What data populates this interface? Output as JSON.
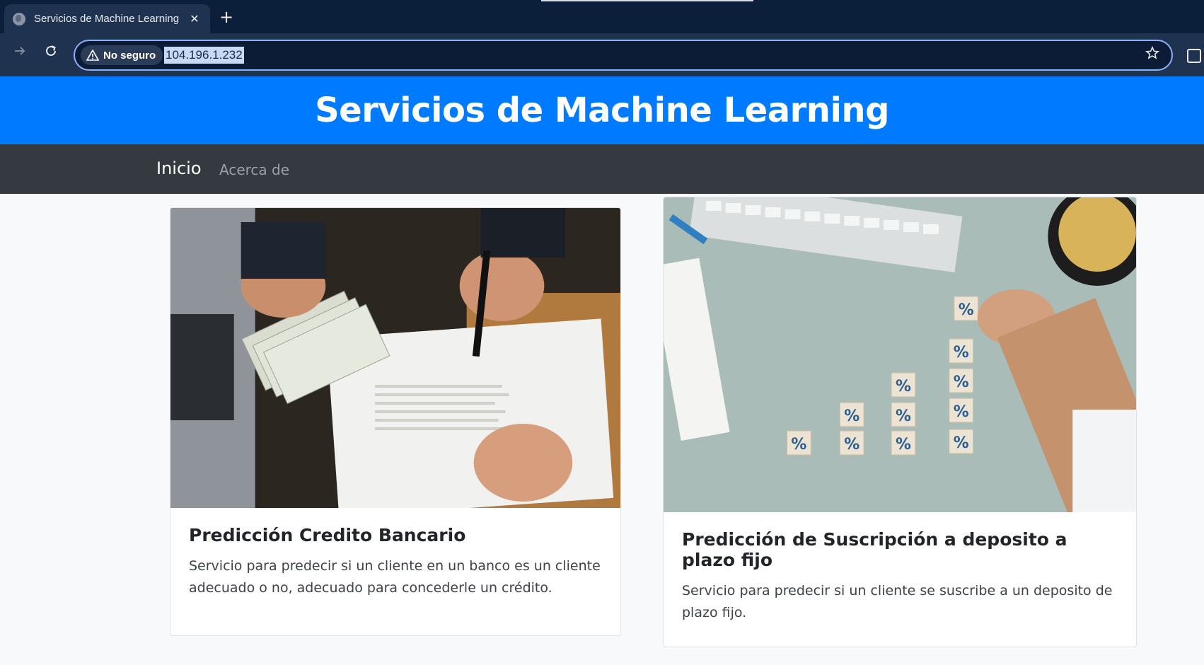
{
  "browser": {
    "tab_title": "Servicios de Machine Learning",
    "tab_close": "✕",
    "new_tab": "+",
    "security_chip": "No seguro",
    "url": "104.196.1.232"
  },
  "header": {
    "title": "Servicios de Machine Learning"
  },
  "nav": {
    "items": [
      {
        "label": "Inicio"
      },
      {
        "label": "Acerca de"
      }
    ]
  },
  "cards": [
    {
      "title": "Predicción Credito Bancario",
      "text": "Servicio para predecir si un cliente en un banco es un cliente adecuado o no, adecuado para concederle un crédito."
    },
    {
      "title": "Predicción de Suscripción a deposito a plazo fijo",
      "text": "Servicio para predecir si un cliente se suscribe a un deposito de plazo fijo."
    }
  ],
  "icons": {
    "back": "arrow-right-icon",
    "reload": "reload-icon",
    "warning": "warning-icon",
    "bookmark": "star-icon",
    "extensions": "extensions-icon"
  },
  "colors": {
    "header_bg": "#007bff",
    "navbar_bg": "#343a40",
    "browser_bg": "#0b1e3a"
  }
}
